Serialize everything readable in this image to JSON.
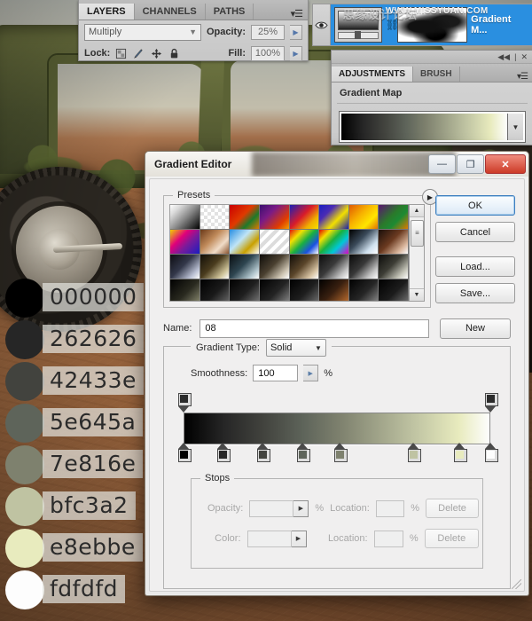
{
  "layers_panel": {
    "tabs": [
      {
        "label": "LAYERS",
        "active": true
      },
      {
        "label": "CHANNELS",
        "active": false
      },
      {
        "label": "PATHS",
        "active": false
      }
    ],
    "menu_icon": "panel-menu-icon",
    "blend_mode": "Multiply",
    "opacity_label": "Opacity:",
    "opacity_value": "25%",
    "lock_label": "Lock:",
    "lock_icons": [
      "lock-transparency-icon",
      "lock-paint-icon",
      "lock-position-icon",
      "lock-all-icon"
    ],
    "fill_label": "Fill:",
    "fill_value": "100%"
  },
  "layer_strip": {
    "visibility_icon": "eye-icon",
    "gradient_thumbnail": "gradient-map-thumbnail",
    "link_icon": "link-icon",
    "mask_thumbnail": "layer-mask-thumbnail",
    "layer_name": "Gradient M...",
    "watermark": "WWW.MISSYUAN.COM",
    "watermark_cn": "思缘设计论坛"
  },
  "adjustments_panel": {
    "collapse_icon": "collapse-icon",
    "close_icon": "close-icon",
    "tabs": [
      {
        "label": "ADJUSTMENTS",
        "active": true
      },
      {
        "label": "BRUSH",
        "active": false
      }
    ],
    "menu_icon": "panel-menu-icon",
    "title": "Gradient Map",
    "gradient_dropdown_icon": "chevron-down-icon"
  },
  "gradient_editor": {
    "title": "Gradient Editor",
    "window_buttons": [
      {
        "name": "minimize-button",
        "glyph": "—"
      },
      {
        "name": "maximize-button",
        "glyph": "❐"
      },
      {
        "name": "close-button",
        "glyph": "✕"
      }
    ],
    "presets": {
      "legend": "Presets",
      "flyout_icon": "flyout-menu-icon",
      "scroll_up_icon": "scroll-up-arrow",
      "scroll_down_icon": "scroll-down-arrow",
      "swatches": [
        "linear-gradient(135deg,#ffffff 0%,#d8d8d8 22%,#8a8a8a 52%,#000000 100%)",
        "repeating-conic-gradient(#ffffff 0 25%,#e2e2e2 0 50%) 0 0/8px 8px",
        "linear-gradient(135deg,#c90000 0%,#e03a00 45%,#1d7a2b 70%,#e07a00 100%)",
        "linear-gradient(135deg,#3a0f6e 0%,#7a1b86 35%,#e03c00 75%,#f2a000 100%)",
        "linear-gradient(135deg,#1b20b5 0%,#d81b2a 45%,#f0b000 75%,#f5e000 100%)",
        "linear-gradient(135deg,#1a1ec0 0%,#4a2bb5 30%,#f2e000 62%,#1b1fa8 100%)",
        "linear-gradient(135deg,#e05a00 0%,#f7b200 40%,#ffe600 70%,#e07000 100%)",
        "linear-gradient(135deg,#5a1470 0%,#2a7a2a 45%,#1d8a33 65%,#e07a00 100%)",
        "linear-gradient(135deg,#f2d000 0%,#e0007a 35%,#7a1b9a 60%,#1a1ec0 100%)",
        "linear-gradient(135deg,#6b3a1a 0%,#c08a5a 40%,#f0dcc8 70%,#8a5530 100%)",
        "linear-gradient(135deg,#2a8fe0 0%,#bfe4f7 40%,#c8a000 70%,#ffffff 100%)",
        "repeating-linear-gradient(135deg,#ffffff 0 4px,#dcdcdc 4px 8px)",
        "linear-gradient(135deg,#e01010 0%,#f2e000 25%,#1ab040 50%,#1a50e0 75%,#ffffff 100%)",
        "linear-gradient(135deg,#e00000 0%,#f2e000 22%,#1ab040 45%,#00c8d8 68%,#e000c8 100%)",
        "linear-gradient(135deg,#000000 0%,#3a4a5a 40%,#cfe0ee 75%,#ffffff 100%)",
        "linear-gradient(135deg,#1a0f0a 0%,#6b3a20 45%,#d8b49a 78%,#ffffff 100%)",
        "linear-gradient(135deg,#0d0d12 0%,#33384a 45%,#b9bfd2 80%,#ffffff 100%)",
        "linear-gradient(135deg,#120f08 0%,#4a3c1e 45%,#cfc49a 80%,#ffffff 100%)",
        "linear-gradient(135deg,#0a0f12 0%,#2e4550 45%,#b0c4cc 80%,#ffffff 100%)",
        "linear-gradient(135deg,#0f0d0a 0%,#4a4030 45%,#cfc6b4 80%,#ffffff 100%)",
        "linear-gradient(135deg,#110d08 0%,#5a452a 45%,#d8c4a4 80%,#ffffff 100%)",
        "linear-gradient(135deg,#0d0d0d 0%,#3a3a3a 45%,#c4c4c4 80%,#ffffff 100%)",
        "linear-gradient(135deg,#0a0a0a 0%,#383838 45%,#c8c8c8 80%,#ffffff 100%)",
        "linear-gradient(135deg,#0c0c0a 0%,#3e3e36 45%,#c6c6ba 80%,#ffffff 100%)",
        "linear-gradient(135deg,#000000 0%,#2a2a20 55%,#8a8a70 100%)",
        "linear-gradient(135deg,#000000 0%,#1a1a1a 55%,#6a6a6a 100%)",
        "linear-gradient(135deg,#000000 0%,#202020 55%,#7a7a7a 100%)",
        "linear-gradient(135deg,#000000 0%,#242424 55%,#8a8a8a 100%)",
        "linear-gradient(135deg,#000000 0%,#1e1e1e 55%,#707070 100%)",
        "linear-gradient(135deg,#000000 0%,#3a2010 50%,#c07030 100%)",
        "linear-gradient(135deg,#000000 0%,#262626 55%,#8c8c8c 100%)",
        "linear-gradient(135deg,#000000 0%,#1c1c1c 55%,#747474 100%)"
      ]
    },
    "buttons": [
      {
        "name": "ok-button",
        "label": "OK",
        "primary": true
      },
      {
        "name": "cancel-button",
        "label": "Cancel",
        "primary": false
      },
      {
        "name": "load-button",
        "label": "Load...",
        "primary": false
      },
      {
        "name": "save-button",
        "label": "Save...",
        "primary": false
      }
    ],
    "name_label": "Name:",
    "name_value": "08",
    "new_button_label": "New",
    "gradient_type_label": "Gradient Type:",
    "gradient_type_value": "Solid",
    "smoothness_label": "Smoothness:",
    "smoothness_value": "100",
    "smoothness_unit": "%",
    "gradient_css": "linear-gradient(90deg,#000000 0%,#262626 13%,#42433e 26%,#5e645a 39%,#7e816e 51%,#bfc3a2 75%,#e8ebbe 90%,#fdfdfd 100%)",
    "opacity_stops": [
      {
        "name": "opacity-stop-start",
        "position_pct": 0
      },
      {
        "name": "opacity-stop-end",
        "position_pct": 100
      }
    ],
    "color_stops": [
      {
        "color": "#000000",
        "position_pct": 0
      },
      {
        "color": "#262626",
        "position_pct": 13
      },
      {
        "color": "#42433e",
        "position_pct": 26
      },
      {
        "color": "#5e645a",
        "position_pct": 39
      },
      {
        "color": "#7e816e",
        "position_pct": 51
      },
      {
        "color": "#bfc3a2",
        "position_pct": 75
      },
      {
        "color": "#e8ebbe",
        "position_pct": 90
      },
      {
        "color": "#fdfdfd",
        "position_pct": 100
      }
    ],
    "stops": {
      "legend": "Stops",
      "opacity_label": "Opacity:",
      "opacity_value": "",
      "opacity_unit": "%",
      "opacity_location_label": "Location:",
      "opacity_location_value": "",
      "opacity_location_unit": "%",
      "opacity_delete_label": "Delete",
      "color_label": "Color:",
      "color_location_label": "Location:",
      "color_location_value": "",
      "color_location_unit": "%",
      "color_delete_label": "Delete"
    },
    "resize_grip_icon": "resize-grip-icon"
  },
  "color_swatches": [
    {
      "hex": "000000",
      "css": "#000000"
    },
    {
      "hex": "262626",
      "css": "#262626"
    },
    {
      "hex": "42433e",
      "css": "#42433e"
    },
    {
      "hex": "5e645a",
      "css": "#5e645a"
    },
    {
      "hex": "7e816e",
      "css": "#7e816e"
    },
    {
      "hex": "bfc3a2",
      "css": "#bfc3a2"
    },
    {
      "hex": "e8ebbe",
      "css": "#e8ebbe"
    },
    {
      "hex": "fdfdfd",
      "css": "#fdfdfd"
    }
  ]
}
